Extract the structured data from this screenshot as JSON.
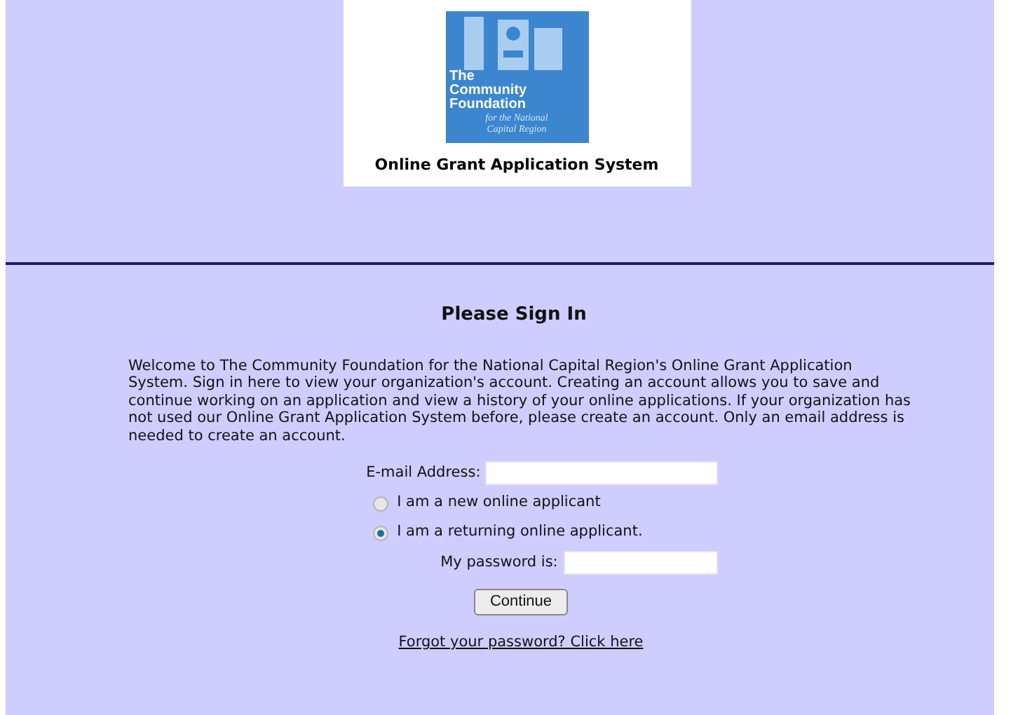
{
  "logo": {
    "name_lines": [
      "The",
      "Community",
      "Foundation"
    ],
    "tagline_lines": [
      "for the National",
      "Capital Region"
    ]
  },
  "site_title": "Online Grant Application System",
  "heading": "Please Sign In",
  "intro": "Welcome to The Community Foundation for the National Capital Region's Online Grant Application System. Sign in here to view your organization's account. Creating an account allows you to save and continue working on an application and view a history of your online applications. If your organization has not used our Online Grant Application System before, please create an account. Only an email address is needed to create an account.",
  "email_label": "E-mail Address:",
  "applicant_options": [
    {
      "label": "I am a new online applicant",
      "selected": false
    },
    {
      "label": "I am a returning online applicant.",
      "selected": true
    }
  ],
  "password_label": "My password is:",
  "continue_button": "Continue",
  "forgot_link": "Forgot your password? Click here"
}
